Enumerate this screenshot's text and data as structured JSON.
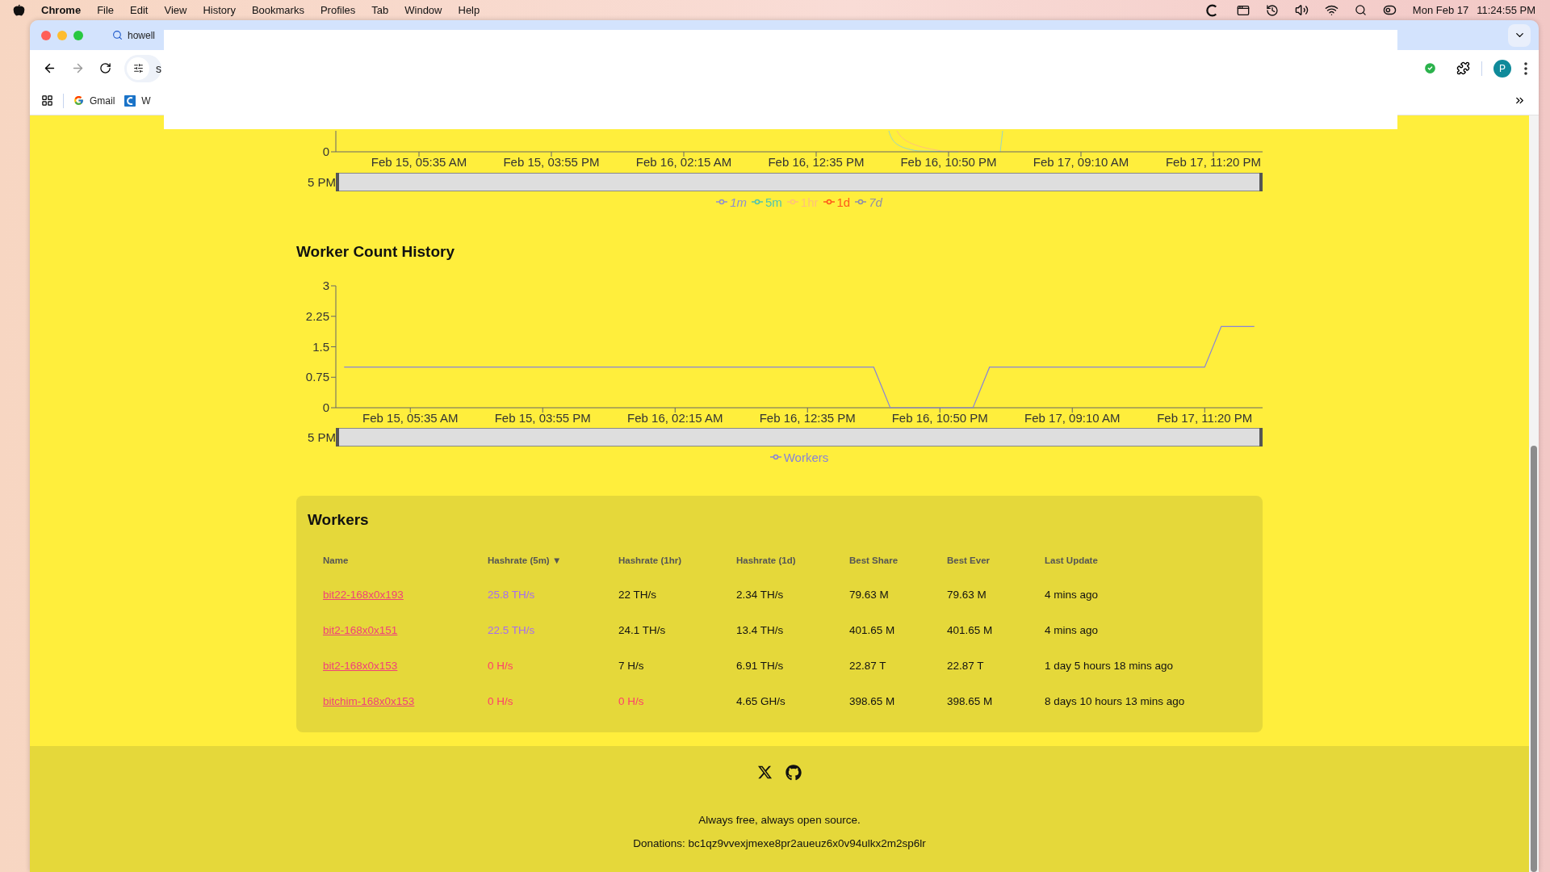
{
  "menu_bar": {
    "app": "Chrome",
    "menus": [
      "File",
      "Edit",
      "View",
      "History",
      "Bookmarks",
      "Profiles",
      "Tab",
      "Window",
      "Help"
    ],
    "date": "Mon Feb 17",
    "time": "11:24:55 PM"
  },
  "browser": {
    "tab_title": "howell",
    "address": "s",
    "profile_initial": "P",
    "bookmarks": [
      {
        "label": "Gmail",
        "kind": "google"
      },
      {
        "label": "W",
        "kind": "site"
      }
    ]
  },
  "hashrate_chart": {
    "y_tick": "0",
    "x_labels": [
      "Feb 15, 05:35 AM",
      "Feb 15, 03:55 PM",
      "Feb 16, 02:15 AM",
      "Feb 16, 12:35 PM",
      "Feb 16, 10:50 PM",
      "Feb 17, 09:10 AM",
      "Feb 17, 11:20 PM"
    ],
    "brush_label": "5 PM",
    "legend": [
      {
        "label": "1m",
        "color": "#8f8fd0",
        "hidden": true
      },
      {
        "label": "5m",
        "color": "#4fc3b0",
        "hidden": false
      },
      {
        "label": "1hr",
        "color": "#ffc27a",
        "hidden": false
      },
      {
        "label": "1d",
        "color": "#ff5a1a",
        "hidden": false
      },
      {
        "label": "7d",
        "color": "#8e8ea8",
        "hidden": true
      }
    ]
  },
  "worker_chart": {
    "brush_label": "5 PM",
    "chart_data": {
      "type": "line",
      "title": "Worker Count History",
      "categories": [
        null,
        null,
        null,
        null,
        "Feb 15, 05:35 AM",
        null,
        null,
        null,
        null,
        null,
        null,
        null,
        "Feb 15, 03:55 PM",
        null,
        null,
        null,
        null,
        null,
        null,
        null,
        "Feb 16, 02:15 AM",
        null,
        null,
        null,
        null,
        null,
        null,
        null,
        "Feb 16, 12:35 PM",
        null,
        null,
        null,
        null,
        null,
        null,
        null,
        "Feb 16, 10:50 PM",
        null,
        null,
        null,
        null,
        null,
        null,
        null,
        "Feb 17, 09:10 AM",
        null,
        null,
        null,
        null,
        null,
        null,
        null,
        "Feb 17, 11:20 PM",
        null,
        null,
        null
      ],
      "series": [
        {
          "name": "Workers",
          "color": "#8884d8",
          "values": [
            1,
            1,
            1,
            1,
            1,
            1,
            1,
            1,
            1,
            1,
            1,
            1,
            1,
            1,
            1,
            1,
            1,
            1,
            1,
            1,
            1,
            1,
            1,
            1,
            1,
            1,
            1,
            1,
            1,
            1,
            1,
            1,
            1,
            0,
            0,
            0,
            0,
            0,
            0,
            1,
            1,
            1,
            1,
            1,
            1,
            1,
            1,
            1,
            1,
            1,
            1,
            1,
            1,
            2,
            2,
            2
          ]
        }
      ],
      "ylim": [
        0,
        3
      ],
      "yticks": [
        0,
        0.75,
        1.5,
        2.25,
        3
      ]
    }
  },
  "workers": {
    "title": "Workers",
    "columns": [
      {
        "label": "Name"
      },
      {
        "label": "Hashrate (5m)",
        "sort_mark": "▼"
      },
      {
        "label": "Hashrate (1hr)"
      },
      {
        "label": "Hashrate (1d)"
      },
      {
        "label": "Best Share"
      },
      {
        "label": "Best Ever"
      },
      {
        "label": "Last Update"
      }
    ],
    "rows": [
      {
        "cells": [
          {
            "kind": "link",
            "text": "bit22-168x0x193"
          },
          {
            "kind": "text",
            "text": "25.8 TH/s",
            "color": "#a66cf2"
          },
          {
            "kind": "text",
            "text": "22 TH/s"
          },
          {
            "kind": "text",
            "text": "2.34 TH/s"
          },
          {
            "kind": "text",
            "text": "79.63 M"
          },
          {
            "kind": "text",
            "text": "79.63 M"
          },
          {
            "kind": "text",
            "text": "4 mins ago"
          }
        ]
      },
      {
        "cells": [
          {
            "kind": "link",
            "text": "bit2-168x0x151"
          },
          {
            "kind": "text",
            "text": "22.5 TH/s",
            "color": "#a66cf2"
          },
          {
            "kind": "text",
            "text": "24.1 TH/s"
          },
          {
            "kind": "text",
            "text": "13.4 TH/s"
          },
          {
            "kind": "text",
            "text": "401.65 M"
          },
          {
            "kind": "text",
            "text": "401.65 M"
          },
          {
            "kind": "text",
            "text": "4 mins ago"
          }
        ]
      },
      {
        "cells": [
          {
            "kind": "link",
            "text": "bit2-168x0x153"
          },
          {
            "kind": "text",
            "text": "0 H/s",
            "color": "#ff3d6b"
          },
          {
            "kind": "text",
            "text": "7 H/s"
          },
          {
            "kind": "text",
            "text": "6.91 TH/s"
          },
          {
            "kind": "text",
            "text": "22.87 T"
          },
          {
            "kind": "text",
            "text": "22.87 T"
          },
          {
            "kind": "text",
            "text": "1 day 5 hours 18 mins ago"
          }
        ]
      },
      {
        "cells": [
          {
            "kind": "link",
            "text": "bitchim-168x0x153"
          },
          {
            "kind": "text",
            "text": "0 H/s",
            "color": "#ff3d6b"
          },
          {
            "kind": "text",
            "text": "0 H/s",
            "color": "#ff3d6b"
          },
          {
            "kind": "text",
            "text": "4.65 GH/s"
          },
          {
            "kind": "text",
            "text": "398.65 M"
          },
          {
            "kind": "text",
            "text": "398.65 M"
          },
          {
            "kind": "text",
            "text": "8 days 10 hours 13 mins ago"
          }
        ]
      }
    ]
  },
  "footer": {
    "tagline": "Always free, always open source.",
    "donations": "Donations: bc1qz9vvexjmexe8pr2aueuz6x0v94ulkx2m2sp6lr"
  }
}
